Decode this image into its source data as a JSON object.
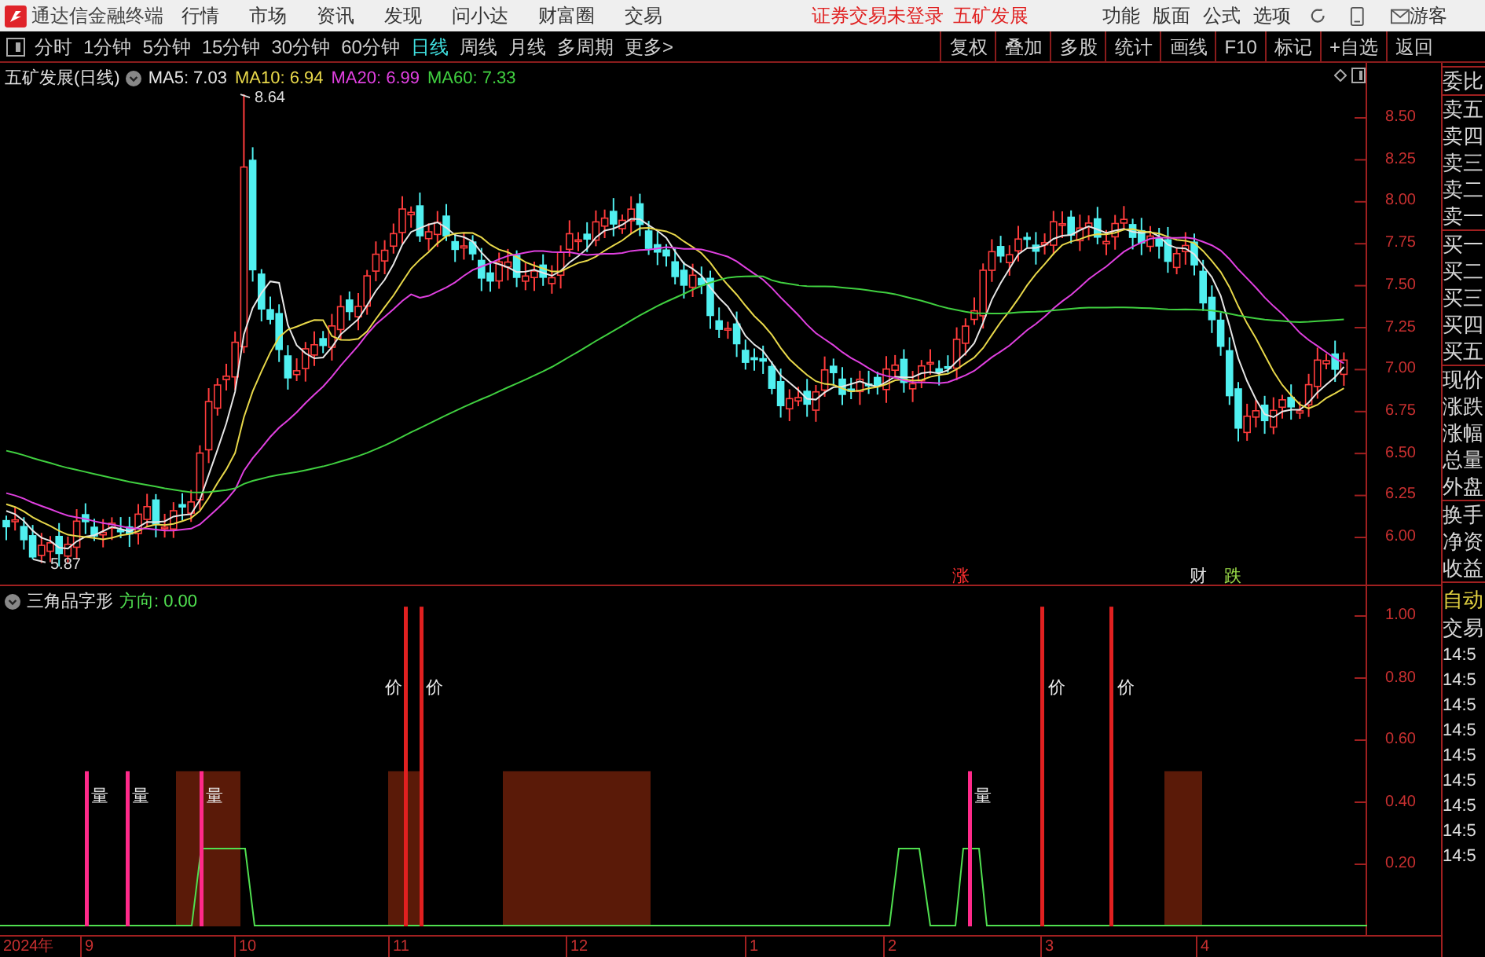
{
  "app": {
    "title": "通达信金融终端",
    "menu": [
      "行情",
      "市场",
      "资讯",
      "发现",
      "问小达",
      "财富圈",
      "交易"
    ],
    "notices": [
      "证券交易未登录",
      "五矿发展"
    ],
    "right_menu": [
      "功能",
      "版面",
      "公式",
      "选项"
    ],
    "user": "游客"
  },
  "toolbar": {
    "periods": [
      {
        "label": "分时",
        "selected": false
      },
      {
        "label": "1分钟",
        "selected": false
      },
      {
        "label": "5分钟",
        "selected": false
      },
      {
        "label": "15分钟",
        "selected": false
      },
      {
        "label": "30分钟",
        "selected": false
      },
      {
        "label": "60分钟",
        "selected": false
      },
      {
        "label": "日线",
        "selected": true
      },
      {
        "label": "周线",
        "selected": false
      },
      {
        "label": "月线",
        "selected": false
      },
      {
        "label": "多周期",
        "selected": false
      },
      {
        "label": "更多>",
        "selected": false
      }
    ],
    "buttons": [
      "复权",
      "叠加",
      "多股",
      "统计",
      "画线",
      "F10",
      "标记",
      "+自选",
      "返回"
    ]
  },
  "main_chart": {
    "title": "五矿发展(日线)",
    "ma": [
      {
        "label": "MA5: 7.03",
        "color": "#e6e6e6"
      },
      {
        "label": "MA10: 6.94",
        "color": "#e8d84a"
      },
      {
        "label": "MA20: 6.99",
        "color": "#e040e0"
      },
      {
        "label": "MA60: 7.33",
        "color": "#40d040"
      }
    ],
    "high_label": "8.64",
    "low_label": "5.87",
    "markers": [
      {
        "text": "涨",
        "color": "#ff3030"
      },
      {
        "text": "财",
        "color": "#e0e0e0"
      },
      {
        "text": "跌",
        "color": "#9ee04a"
      }
    ],
    "y_axis": [
      "8.50",
      "8.25",
      "8.00",
      "7.75",
      "7.50",
      "7.25",
      "7.00",
      "6.75",
      "6.50",
      "6.25",
      "6.00"
    ]
  },
  "indicator": {
    "title": "三角品字形",
    "reading": "方向: 0.00",
    "y_axis": [
      "1.00",
      "0.80",
      "0.60",
      "0.40",
      "0.20"
    ],
    "signals": [
      {
        "kind": "volume",
        "label": "量"
      },
      {
        "kind": "volume",
        "label": "量"
      },
      {
        "kind": "volume",
        "label": "量"
      },
      {
        "kind": "price",
        "label": "价"
      },
      {
        "kind": "price",
        "label": "价"
      },
      {
        "kind": "volume",
        "label": "量"
      },
      {
        "kind": "price",
        "label": "价"
      },
      {
        "kind": "price",
        "label": "价"
      }
    ]
  },
  "x_axis": [
    "2024年",
    "9",
    "10",
    "11",
    "12",
    "1",
    "2",
    "3",
    "4"
  ],
  "right_panel": {
    "groups": [
      [
        "委比"
      ],
      [
        "卖五",
        "卖四",
        "卖三",
        "卖二",
        "卖一"
      ],
      [
        "买一",
        "买二",
        "买三",
        "买四",
        "买五"
      ],
      [
        "现价",
        "涨跌",
        "涨幅",
        "总量",
        "外盘"
      ],
      [
        "换手",
        "净资",
        "收益"
      ]
    ],
    "mode": "自动",
    "trades_title": "交易",
    "trades": [
      "14:5",
      "14:5",
      "14:5",
      "14:5",
      "14:5",
      "14:5",
      "14:5",
      "14:5",
      "14:5"
    ]
  }
}
